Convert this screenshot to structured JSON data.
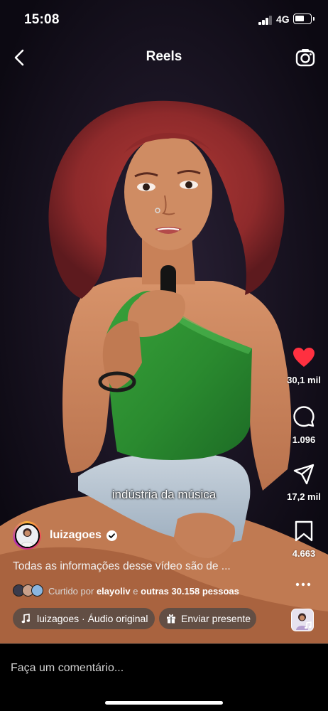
{
  "status_bar": {
    "time": "15:08",
    "network": "4G"
  },
  "header": {
    "title": "Reels"
  },
  "video": {
    "caption": "indústria da música"
  },
  "actions": {
    "likes": "30,1 mil",
    "comments": "1.096",
    "shares": "17,2 mil",
    "saves": "4.663"
  },
  "author": {
    "username": "luizagoes"
  },
  "description": "Todas as informações desse vídeo são de ...",
  "liked_by": {
    "prefix": "Curtido por",
    "user": "elayoliv",
    "connector": "e",
    "others": "outras 30.158 pessoas"
  },
  "audio": {
    "label": "luizagoes · Áudio original"
  },
  "gift": {
    "label": "Enviar presente"
  },
  "comment": {
    "placeholder": "Faça um comentário..."
  },
  "colors": {
    "like": "#ff3040",
    "background": "#000000",
    "top_green": "#2f8a32"
  },
  "icons": [
    "back-chevron-icon",
    "camera-icon",
    "heart-icon",
    "comment-icon",
    "share-icon",
    "bookmark-icon",
    "more-icon",
    "music-note-icon",
    "gift-icon",
    "verified-icon"
  ]
}
